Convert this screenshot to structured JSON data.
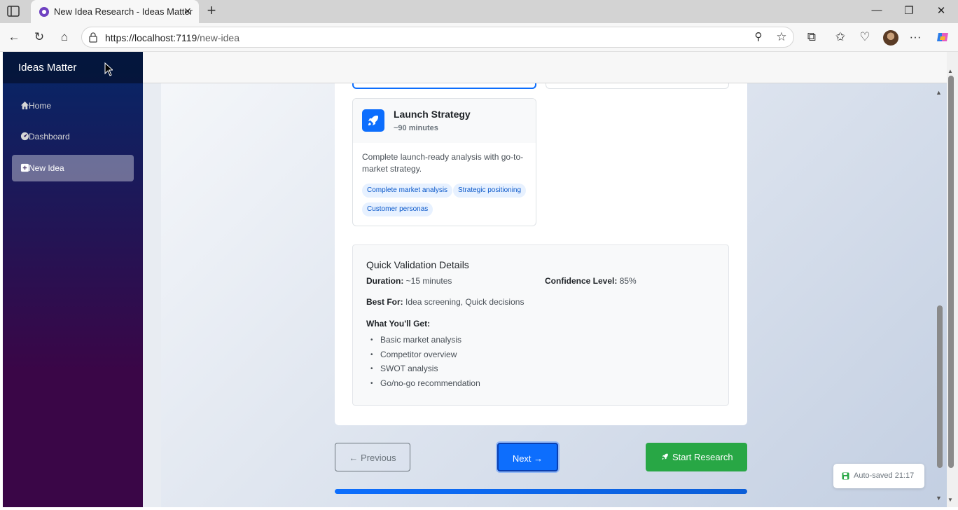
{
  "browser": {
    "tab_title": "New Idea Research - Ideas Matter",
    "url_host": "https://localhost:7119",
    "url_path": "/new-idea",
    "icons": [
      "sidebar-toggle-icon",
      "back-icon",
      "refresh-icon",
      "home-icon",
      "lock-icon",
      "zoom-icon",
      "favorite-icon",
      "extensions-icon",
      "favorites-icon",
      "health-icon",
      "profile-avatar",
      "more-icon",
      "copilot-icon"
    ]
  },
  "sidebar": {
    "brand": "Ideas Matter",
    "items": [
      {
        "label": "Home",
        "icon": "home-icon"
      },
      {
        "label": "Dashboard",
        "icon": "dashboard-icon"
      },
      {
        "label": "New Idea",
        "icon": "plus-square-icon",
        "active": true
      }
    ]
  },
  "option": {
    "title": "Launch Strategy",
    "duration": "~90 minutes",
    "description": "Complete launch-ready analysis with go-to-market strategy.",
    "tags": [
      "Complete market analysis",
      "Strategic positioning",
      "Customer personas"
    ]
  },
  "details": {
    "title": "Quick Validation Details",
    "duration_label": "Duration:",
    "duration_value": "~15 minutes",
    "confidence_label": "Confidence Level:",
    "confidence_value": "85%",
    "best_for_label": "Best For:",
    "best_for_value": "Idea screening, Quick decisions",
    "get_title": "What You'll Get:",
    "get_items": [
      "Basic market analysis",
      "Competitor overview",
      "SWOT analysis",
      "Go/no-go recommendation"
    ]
  },
  "actions": {
    "previous": "Previous",
    "next": "Next",
    "start": "Start Research"
  },
  "progress": 1.0,
  "autosave": "Auto-saved 21:17",
  "colors": {
    "primary": "#0d6efd",
    "success": "#28a745",
    "sidebar_top": "#052767",
    "sidebar_bottom": "#3a0647"
  }
}
